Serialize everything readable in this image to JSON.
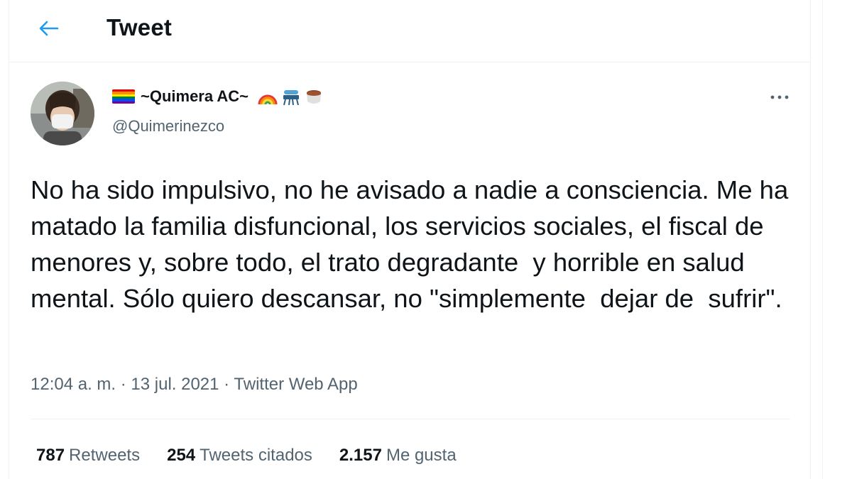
{
  "header": {
    "title": "Tweet",
    "back_icon": "arrow-left-icon",
    "accent_color": "#1d9bf0"
  },
  "author": {
    "display_name": "~Quimera AC~",
    "handle": "@Quimerinezco",
    "name_emojis": [
      "rainbow-flag-icon",
      "rainbow-icon",
      "stove-icon",
      "pot-icon"
    ]
  },
  "tweet": {
    "text": "No ha sido impulsivo, no he avisado a nadie a consciencia. Me ha matado la familia disfuncional, los servicios sociales, el fiscal de menores y, sobre todo, el trato degradante  y horrible en salud mental. Sólo quiero descansar, no \"simplemente  dejar de  sufrir\".",
    "meta": "12:04 a. m. · 13 jul. 2021 · Twitter Web App"
  },
  "stats": {
    "retweets": {
      "count": "787",
      "label": "Retweets"
    },
    "quotes": {
      "count": "254",
      "label": "Tweets citados"
    },
    "likes": {
      "count": "2.157",
      "label": "Me gusta"
    }
  },
  "more_icon": "more-horizontal-icon"
}
